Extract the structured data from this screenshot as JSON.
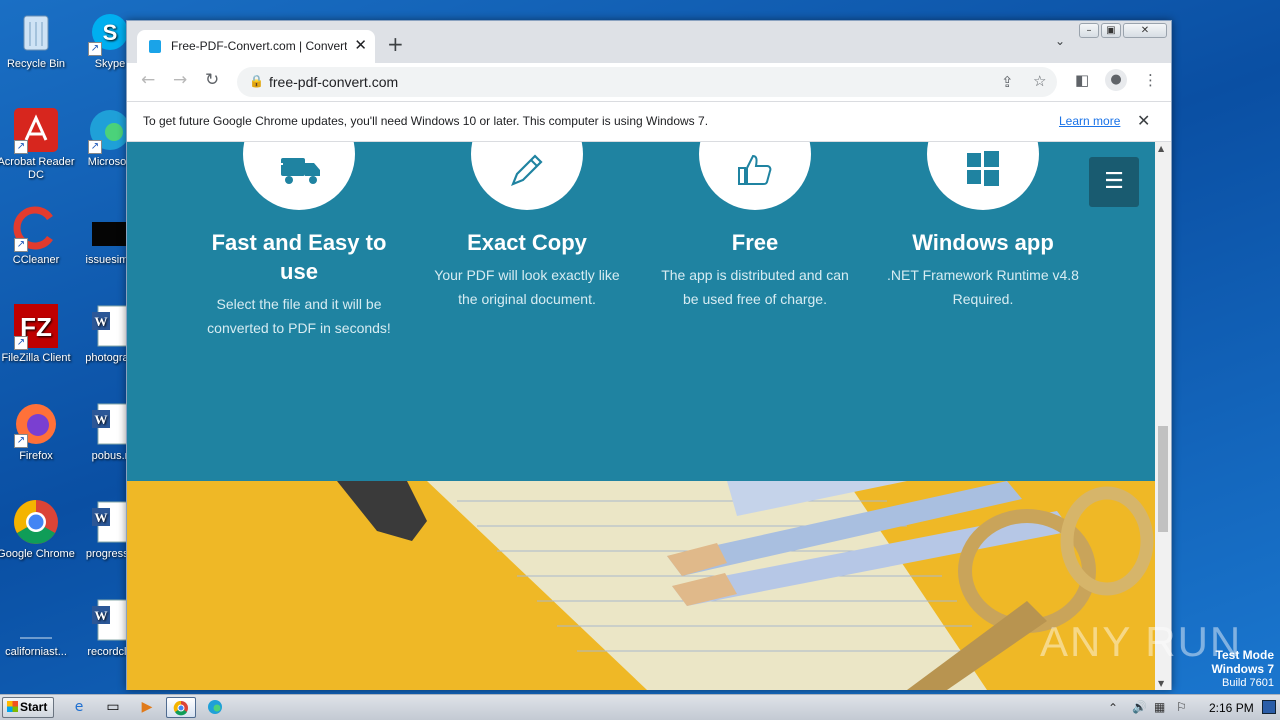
{
  "desktop": {
    "icons": [
      {
        "label": "Recycle Bin",
        "icon": "recycle-bin-icon"
      },
      {
        "label": "Skype",
        "icon": "skype-icon"
      },
      {
        "label": "Acrobat Reader DC",
        "icon": "acrobat-icon"
      },
      {
        "label": "Microsoft",
        "icon": "edge-icon"
      },
      {
        "label": "CCleaner",
        "icon": "ccleaner-icon"
      },
      {
        "label": "issuesimp",
        "icon": "file-icon"
      },
      {
        "label": "FileZilla Client",
        "icon": "filezilla-icon"
      },
      {
        "label": "photograp",
        "icon": "word-doc-icon"
      },
      {
        "label": "Firefox",
        "icon": "firefox-icon"
      },
      {
        "label": "pobus.r",
        "icon": "word-doc-icon"
      },
      {
        "label": "Google Chrome",
        "icon": "chrome-icon"
      },
      {
        "label": "progressc",
        "icon": "word-doc-icon"
      },
      {
        "label": "californiast...",
        "icon": "file-icon"
      },
      {
        "label": "recordclo",
        "icon": "word-doc-icon"
      }
    ]
  },
  "browser": {
    "tab_title": "Free-PDF-Convert.com | Convert hu",
    "new_tab_symbol": "+",
    "url": "free-pdf-convert.com",
    "infobar": {
      "message": "To get future Google Chrome updates, you'll need Windows 10 or later. This computer is using Windows 7.",
      "link": "Learn more"
    }
  },
  "page": {
    "features": [
      {
        "icon": "truck-icon",
        "title": "Fast and Easy to use",
        "text": "Select the file and it will be converted to PDF in seconds!"
      },
      {
        "icon": "pencil-icon",
        "title": "Exact Copy",
        "text": "Your PDF will look exactly like the original document."
      },
      {
        "icon": "thumbs-up-icon",
        "title": "Free",
        "text": "The app is distributed and can be used free of charge."
      },
      {
        "icon": "windows-icon",
        "title": "Windows app",
        "text": ".NET Framework Runtime v4.8 Required."
      }
    ],
    "colors": {
      "teal": "#1f83a1",
      "yellow": "#efb826"
    }
  },
  "watermark": {
    "brand": "ANY RUN",
    "test_mode": "Test Mode",
    "os": "Windows 7",
    "build": "Build 7601"
  },
  "taskbar": {
    "start_label": "Start",
    "clock": "2:16 PM"
  }
}
